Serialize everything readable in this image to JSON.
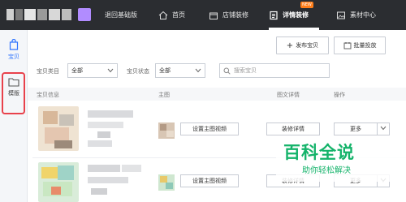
{
  "topbar": {
    "back_label": "退回基础版",
    "home_label": "首页",
    "shop_label": "店铺装修",
    "detail_label": "详情装修",
    "detail_badge": "NEW",
    "material_label": "素材中心"
  },
  "sidebar": {
    "items": [
      {
        "label": "宝贝",
        "icon": "bag-icon"
      },
      {
        "label": "模版",
        "icon": "folder-icon"
      }
    ]
  },
  "toolbar": {
    "publish_label": "发布宝贝",
    "batch_label": "批量投放"
  },
  "filters": {
    "category_label": "宝贝类目",
    "category_value": "全部",
    "status_label": "宝贝状态",
    "status_value": "全部",
    "search_placeholder": "搜索宝贝"
  },
  "table": {
    "columns": [
      "宝贝信息",
      "主图",
      "图文详情",
      "操作"
    ],
    "rows": [
      {
        "main_image_btn": "设置主图视频",
        "detail_btn": "装修详情",
        "more_btn": "更多"
      },
      {
        "main_image_btn": "设置主图视频",
        "detail_btn": "装修详情",
        "more_btn": "更多"
      }
    ]
  },
  "watermark": {
    "title": "百科全说",
    "subtitle": "助你轻松解决"
  },
  "colors": {
    "topbar_bg": "#2b2d31",
    "accent": "#2c72ff",
    "highlight_box": "#e8414b",
    "badge": "#ff7e1a",
    "watermark": "#14b36a"
  }
}
